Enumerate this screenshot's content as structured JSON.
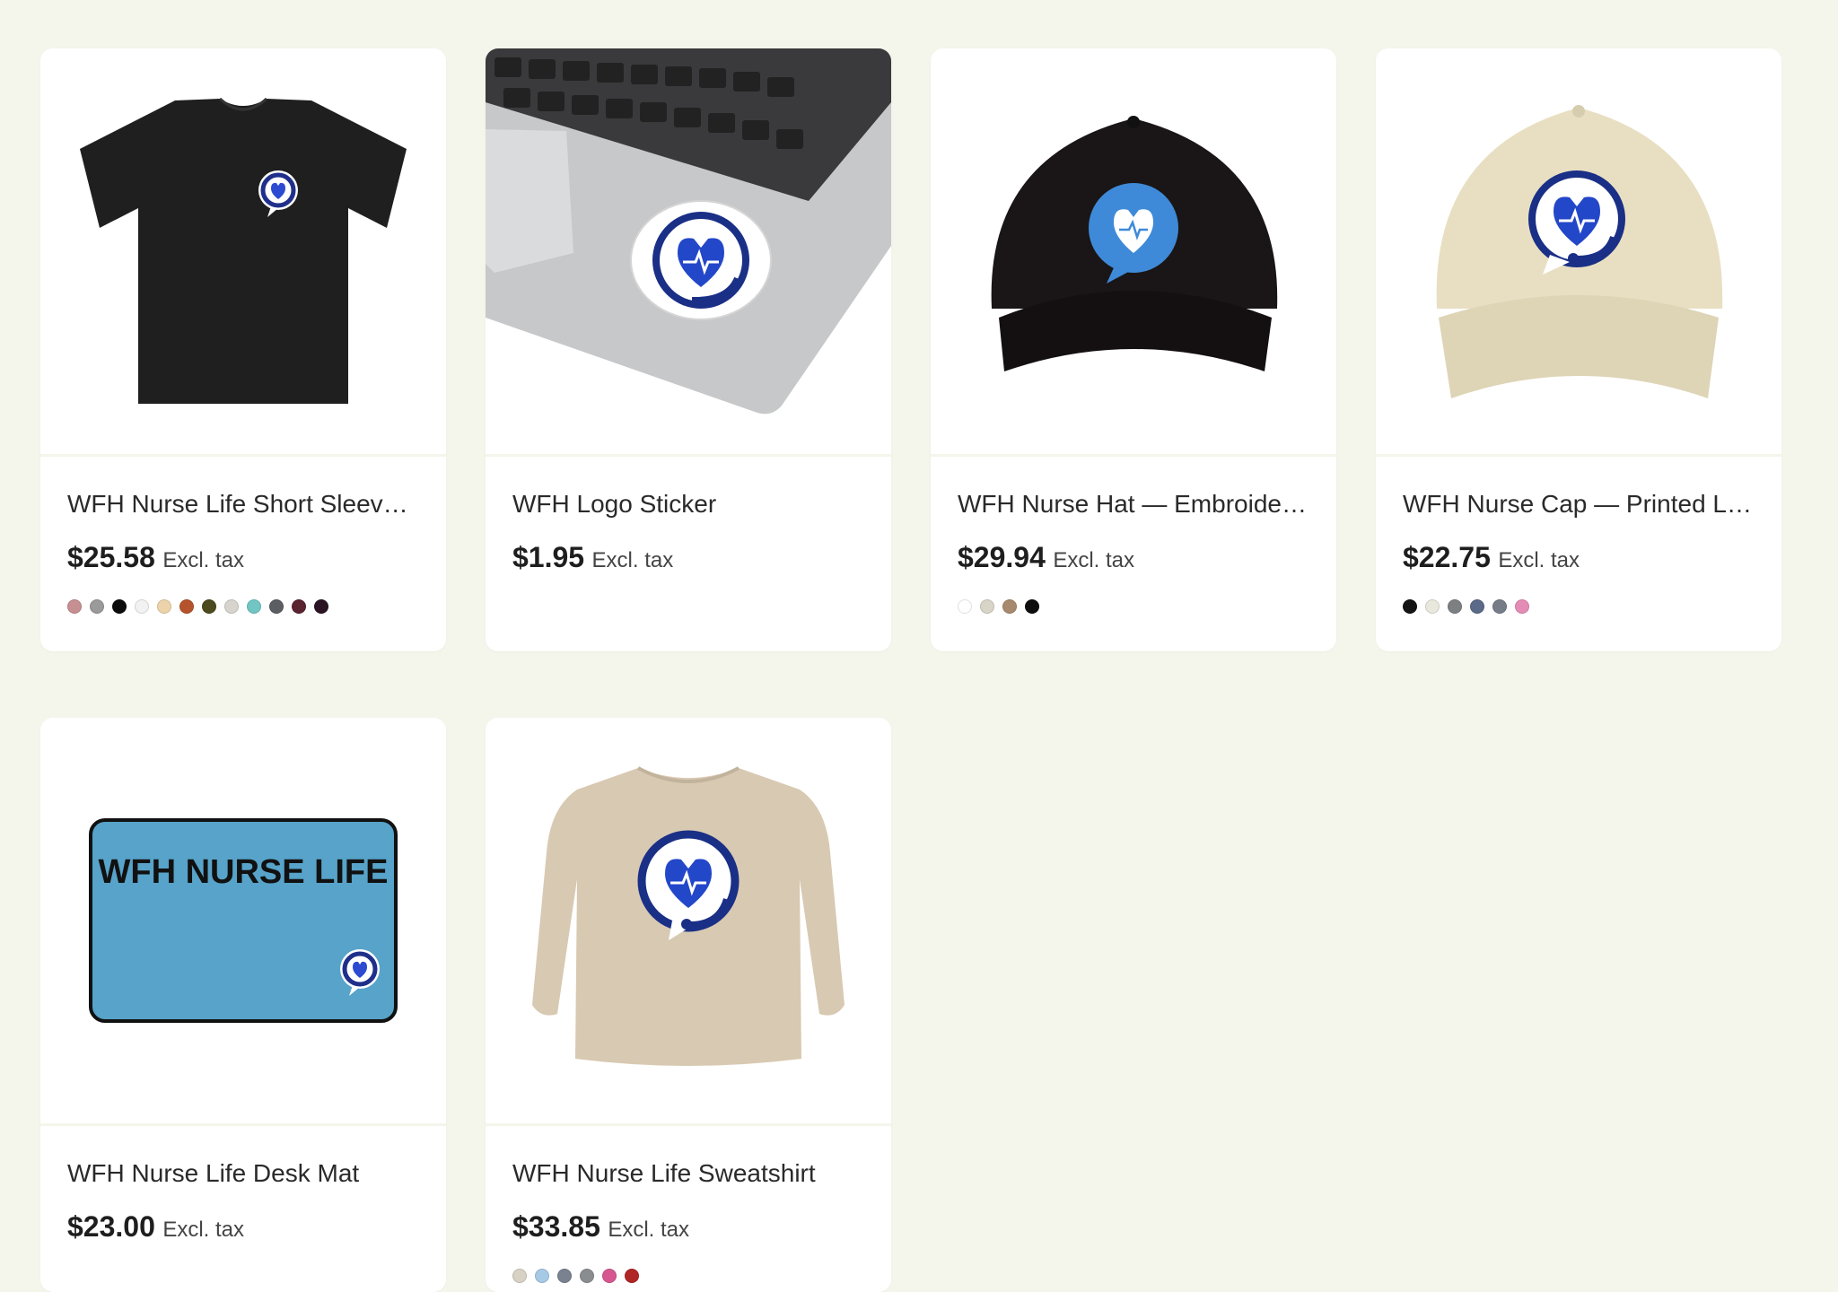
{
  "products": [
    {
      "title": "WFH Nurse Life Short Sleeve…",
      "price": "$25.58",
      "tax_note": "Excl. tax",
      "image_icon": "black-tshirt-image",
      "swatches": [
        "#c78f92",
        "#9a9a9a",
        "#0c0c0c",
        "#f2f2f2",
        "#edd3aa",
        "#b5542c",
        "#4c4a1e",
        "#d6d4cd",
        "#71c6c3",
        "#5b5e63",
        "#5b2230",
        "#2a1424"
      ]
    },
    {
      "title": "WFH Logo Sticker",
      "price": "$1.95",
      "tax_note": "Excl. tax",
      "image_icon": "laptop-sticker-image",
      "swatches": []
    },
    {
      "title": "WFH Nurse Hat — Embroider…",
      "price": "$29.94",
      "tax_note": "Excl. tax",
      "image_icon": "black-cap-image",
      "swatches": [
        "#ffffff",
        "#d8d4c8",
        "#a78a6e",
        "#0e0e0e"
      ]
    },
    {
      "title": "WFH Nurse Cap — Printed Lo…",
      "price": "$22.75",
      "tax_note": "Excl. tax",
      "image_icon": "khaki-cap-image",
      "swatches": [
        "#141414",
        "#e9e8dc",
        "#7d8083",
        "#5a6a88",
        "#767d88",
        "#e58cb6"
      ]
    },
    {
      "title": "WFH Nurse Life Desk Mat",
      "price": "$23.00",
      "tax_note": "Excl. tax",
      "image_icon": "desk-mat-image",
      "mat_text": "WFH NURSE LIFE",
      "swatches": []
    },
    {
      "title": "WFH Nurse Life Sweatshirt",
      "price": "$33.85",
      "tax_note": "Excl. tax",
      "image_icon": "sweatshirt-image",
      "swatches": [
        "#d7d2c4",
        "#a6c9e6",
        "#7a8290",
        "#8a8d90",
        "#d6578f",
        "#b02626"
      ]
    }
  ]
}
